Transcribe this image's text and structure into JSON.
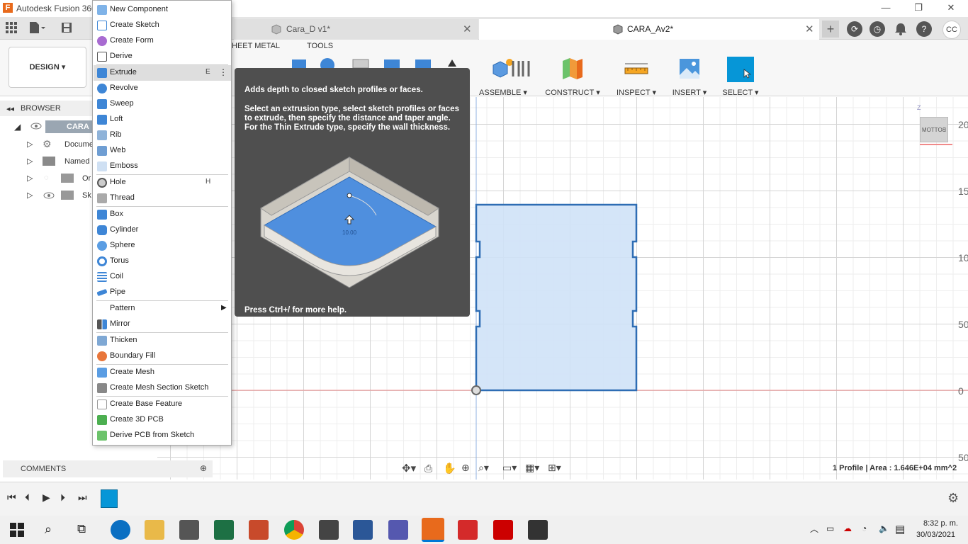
{
  "window": {
    "title": "Autodesk Fusion 360",
    "logo": "F"
  },
  "tabs": [
    {
      "label": "Cara_D v1*"
    },
    {
      "label": "CARA_Av2*"
    }
  ],
  "toolbar": {
    "workspace": "DESIGN",
    "tab_sheet_metal": "HEET METAL",
    "tab_tools": "TOOLS",
    "groups": [
      "ASSEMBLE",
      "CONSTRUCT",
      "INSPECT",
      "INSERT",
      "SELECT"
    ],
    "avatar": "CC"
  },
  "browser": {
    "header": "BROWSER",
    "items": [
      "CARA",
      "Docume",
      "Named",
      "Or",
      "Sk"
    ]
  },
  "comments_label": "COMMENTS",
  "menu": {
    "items": [
      {
        "label": "New Component",
        "shortcut": ""
      },
      {
        "label": "Create Sketch",
        "shortcut": ""
      },
      {
        "label": "Create Form",
        "shortcut": ""
      },
      {
        "label": "Derive",
        "shortcut": ""
      },
      {
        "label": "Extrude",
        "shortcut": "E"
      },
      {
        "label": "Revolve",
        "shortcut": ""
      },
      {
        "label": "Sweep",
        "shortcut": ""
      },
      {
        "label": "Loft",
        "shortcut": ""
      },
      {
        "label": "Rib",
        "shortcut": ""
      },
      {
        "label": "Web",
        "shortcut": ""
      },
      {
        "label": "Emboss",
        "shortcut": ""
      },
      {
        "label": "Hole",
        "shortcut": "H"
      },
      {
        "label": "Thread",
        "shortcut": ""
      },
      {
        "label": "Box",
        "shortcut": ""
      },
      {
        "label": "Cylinder",
        "shortcut": ""
      },
      {
        "label": "Sphere",
        "shortcut": ""
      },
      {
        "label": "Torus",
        "shortcut": ""
      },
      {
        "label": "Coil",
        "shortcut": ""
      },
      {
        "label": "Pipe",
        "shortcut": ""
      },
      {
        "label": "Pattern",
        "shortcut": ""
      },
      {
        "label": "Mirror",
        "shortcut": ""
      },
      {
        "label": "Thicken",
        "shortcut": ""
      },
      {
        "label": "Boundary Fill",
        "shortcut": ""
      },
      {
        "label": "Create Mesh",
        "shortcut": ""
      },
      {
        "label": "Create Mesh Section Sketch",
        "shortcut": ""
      },
      {
        "label": "Create Base Feature",
        "shortcut": ""
      },
      {
        "label": "Create 3D PCB",
        "shortcut": ""
      },
      {
        "label": "Derive PCB from Sketch",
        "shortcut": ""
      }
    ]
  },
  "tooltip": {
    "title": "Adds depth to closed sketch profiles or faces.",
    "description": "Select an extrusion type, select sketch profiles or faces to extrude, then specify the distance and taper angle. For the Thin Extrude type, specify the wall thickness.",
    "illustration_value": "10.00",
    "help": "Press Ctrl+/ for more help."
  },
  "viewport": {
    "axis_labels": [
      "20",
      "15",
      "10",
      "50",
      "0",
      "50"
    ],
    "viewcube": "BOTTOM",
    "status": "1 Profile | Area : 1.646E+04 mm^2"
  },
  "taskbar": {
    "time": "8:32 p. m.",
    "date": "30/03/2021"
  },
  "colors": {
    "accent": "#0696d7",
    "profile_fill": "#cfe2f7",
    "profile_stroke": "#2e6db4",
    "tooltip_bg": "#4f4f4f"
  }
}
